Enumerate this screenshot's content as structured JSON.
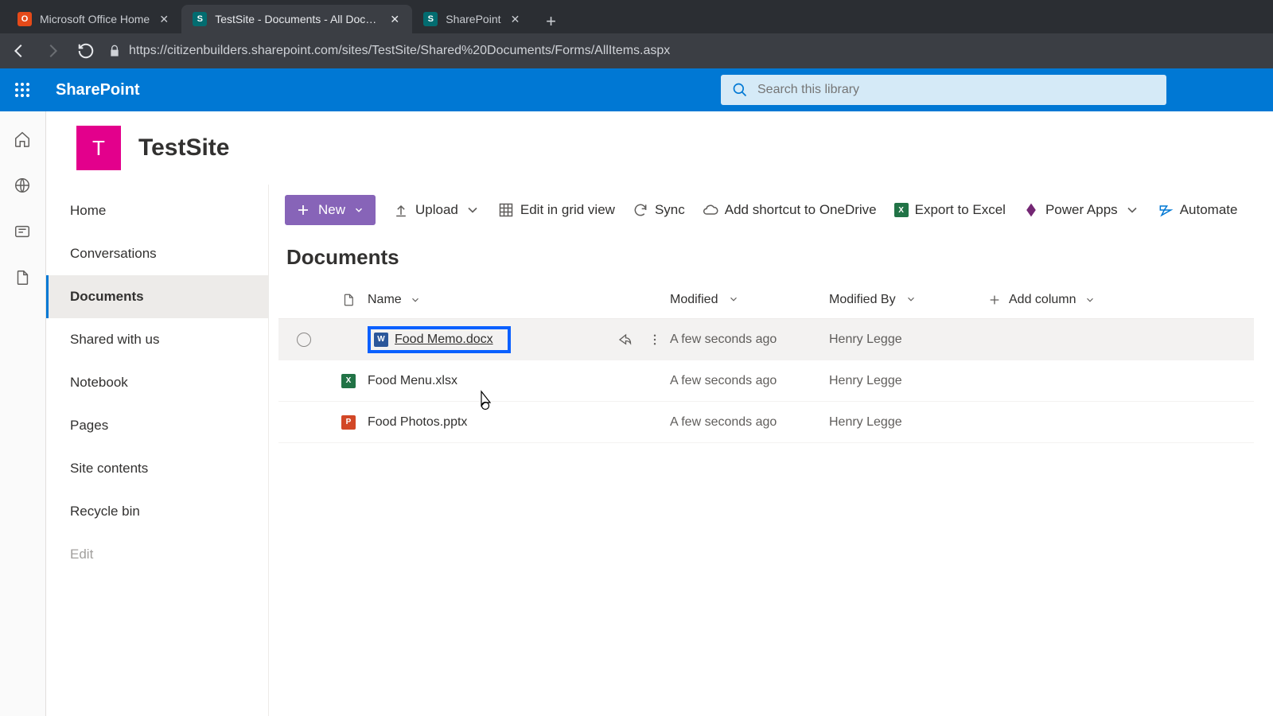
{
  "browser": {
    "tabs": [
      {
        "title": "Microsoft Office Home",
        "fav": "O",
        "favClass": "fav-office"
      },
      {
        "title": "TestSite - Documents - All Docum",
        "fav": "S",
        "favClass": "fav-sp",
        "active": true
      },
      {
        "title": "SharePoint",
        "fav": "S",
        "favClass": "fav-sp"
      }
    ],
    "url": "https://citizenbuilders.sharepoint.com/sites/TestSite/Shared%20Documents/Forms/AllItems.aspx"
  },
  "header": {
    "brand": "SharePoint",
    "search_placeholder": "Search this library"
  },
  "site": {
    "logo_letter": "T",
    "title": "TestSite"
  },
  "sidenav": {
    "items": [
      {
        "label": "Home"
      },
      {
        "label": "Conversations"
      },
      {
        "label": "Documents",
        "active": true
      },
      {
        "label": "Shared with us"
      },
      {
        "label": "Notebook"
      },
      {
        "label": "Pages"
      },
      {
        "label": "Site contents"
      },
      {
        "label": "Recycle bin"
      },
      {
        "label": "Edit",
        "muted": true
      }
    ]
  },
  "commands": {
    "new": "New",
    "upload": "Upload",
    "grid": "Edit in grid view",
    "sync": "Sync",
    "shortcut": "Add shortcut to OneDrive",
    "excel": "Export to Excel",
    "power": "Power Apps",
    "automate": "Automate"
  },
  "page": {
    "title": "Documents"
  },
  "table": {
    "headers": {
      "name": "Name",
      "modified": "Modified",
      "modified_by": "Modified By",
      "add": "Add column"
    },
    "rows": [
      {
        "name": "Food Memo.docx",
        "type": "word",
        "modified": "A few seconds ago",
        "modified_by": "Henry Legge",
        "hovered": true,
        "highlighted": true,
        "underlined": true
      },
      {
        "name": "Food Menu.xlsx",
        "type": "excel",
        "modified": "A few seconds ago",
        "modified_by": "Henry Legge"
      },
      {
        "name": "Food Photos.pptx",
        "type": "ppt",
        "modified": "A few seconds ago",
        "modified_by": "Henry Legge"
      }
    ]
  }
}
